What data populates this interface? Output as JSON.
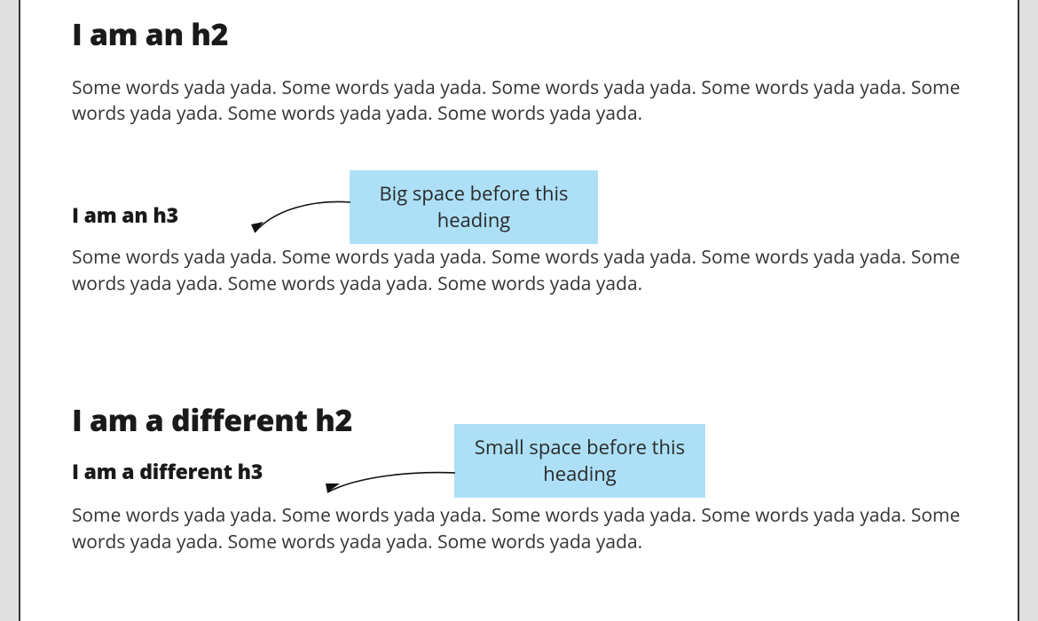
{
  "colors": {
    "callout_bg": "#ade0f7"
  },
  "section1": {
    "h2": "I am an h2",
    "p1": "Some words yada yada. Some words yada yada. Some words yada yada. Some words yada yada. Some words yada yada. Some words yada yada. Some words yada yada.",
    "h3": "I am an h3",
    "p2": "Some words yada yada. Some words yada yada. Some words yada yada. Some words yada yada. Some words yada yada. Some words yada yada. Some words yada yada."
  },
  "section2": {
    "h2": "I am a different h2",
    "h3": "I am a different h3",
    "p1": "Some words yada yada. Some words yada yada. Some words yada yada. Some words yada yada. Some words yada yada. Some words yada yada. Some words yada yada."
  },
  "callout1": "Big space before this heading",
  "callout2": "Small space before this heading"
}
